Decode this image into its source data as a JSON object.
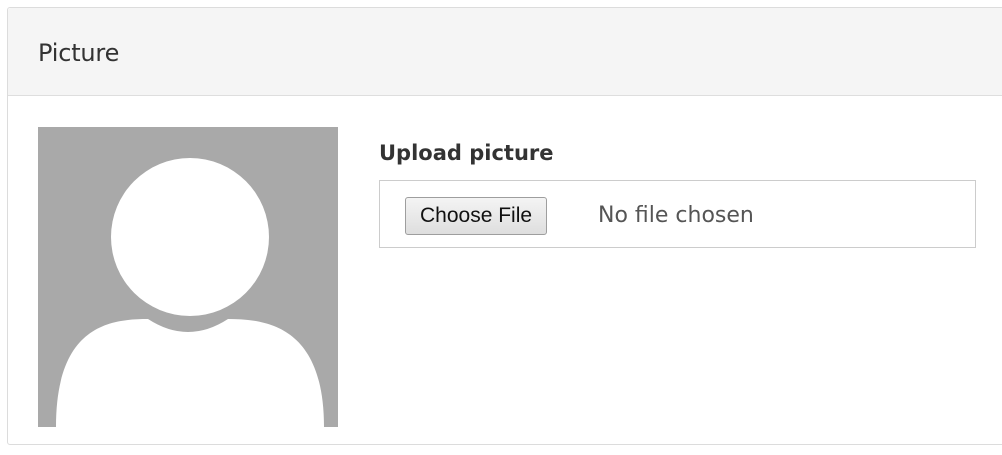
{
  "panel": {
    "title": "Picture"
  },
  "avatar": {
    "icon": "default-user-silhouette-icon",
    "background_color": "#a9a9a9",
    "figure_color": "#ffffff"
  },
  "upload": {
    "label": "Upload picture",
    "button_label": "Choose File",
    "status_text": "No file chosen"
  }
}
